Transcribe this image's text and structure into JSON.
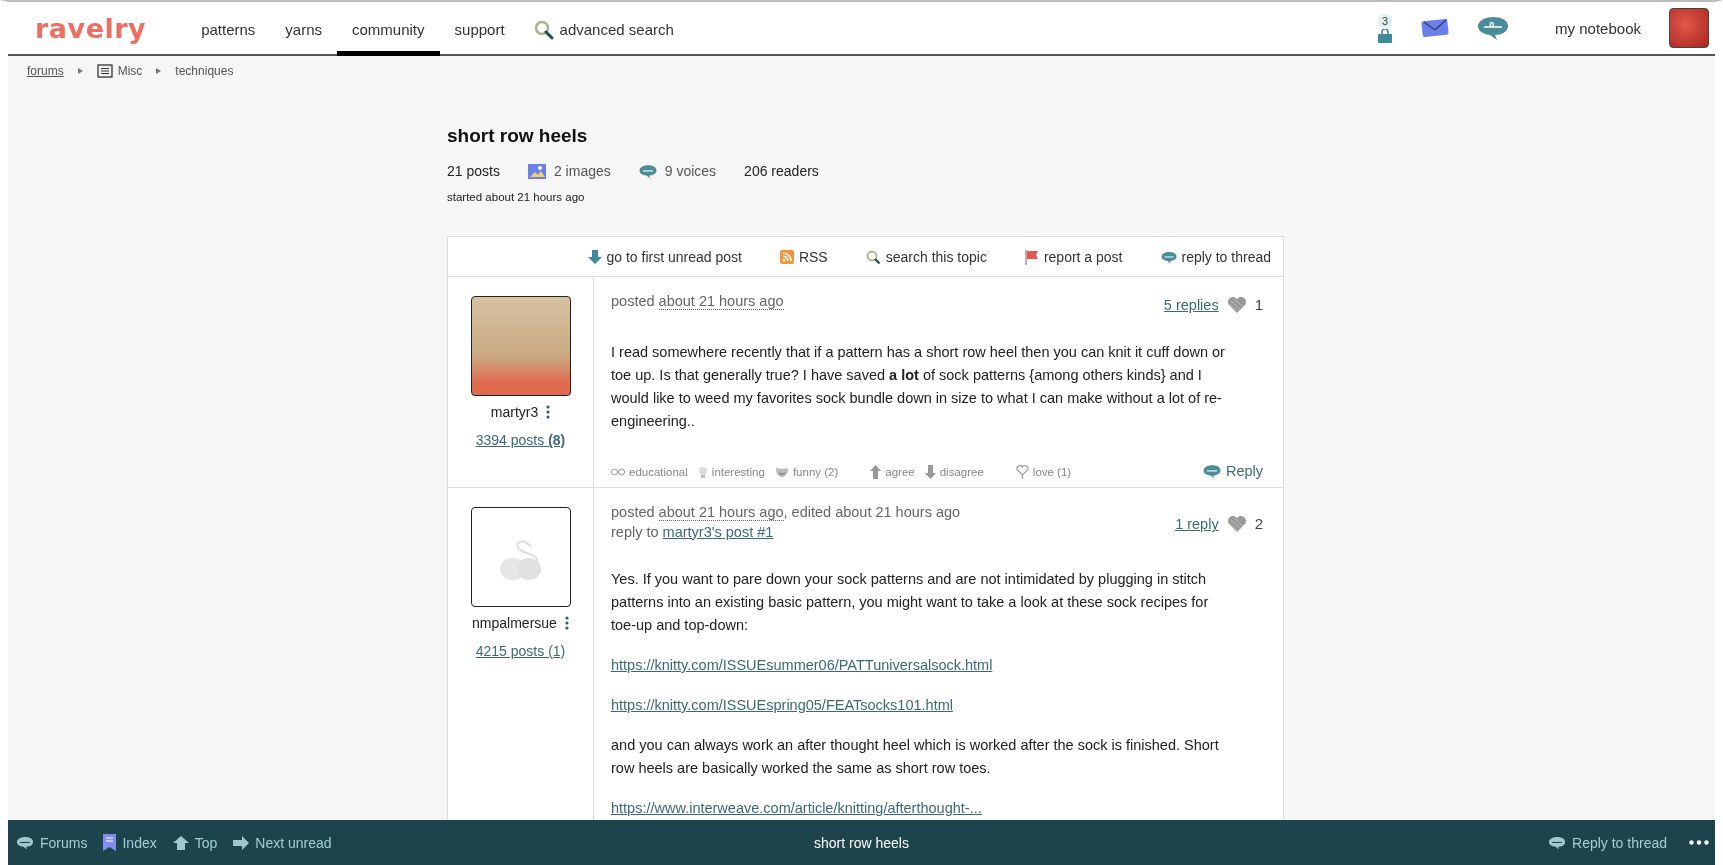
{
  "header": {
    "logo": "ravelry",
    "nav": [
      {
        "label": "patterns",
        "selected": false
      },
      {
        "label": "yarns",
        "selected": false
      },
      {
        "label": "community",
        "selected": true
      },
      {
        "label": "support",
        "selected": false
      }
    ],
    "search_link": "advanced search",
    "cart_badge": "3",
    "notebook": "my notebook"
  },
  "breadcrumb": [
    {
      "label": "forums",
      "kind": "link"
    },
    {
      "label": "Misc",
      "kind": "board"
    },
    {
      "label": "techniques",
      "kind": "plain"
    }
  ],
  "topic": {
    "title": "short row heels",
    "posts": "21 posts",
    "images": "2 images",
    "voices": "9 voices",
    "readers": "206 readers",
    "started": "started about 21 hours ago"
  },
  "toolbar": [
    {
      "label": "go to first unread post",
      "kind": "down"
    },
    {
      "label": "RSS",
      "kind": "rss"
    },
    {
      "label": "search this topic",
      "kind": "search"
    },
    {
      "label": "report a post",
      "kind": "flag"
    },
    {
      "label": "reply to thread",
      "kind": "bubble"
    }
  ],
  "posts": [
    {
      "author": "martyr3",
      "kind": "photo",
      "posts_link": "3394 posts **(8)**",
      "posted": "posted",
      "time": "about 21 hours ago",
      "replies": "5 replies",
      "likes": "1",
      "body": [
        {
          "kind": "text",
          "text": "I read somewhere recently that if a pattern has a short row heel then you can knit it cuff down or toe up. Is that generally true? I have saved **a lot** of sock patterns {among others kinds} and I would like to weed my favorites sock bundle down in size to what I can make without a lot of re-engineering.."
        }
      ],
      "reactions": [
        {
          "label": "educational",
          "kind": "glasses"
        },
        {
          "label": "interesting",
          "kind": "bulb"
        },
        {
          "label": "funny (2)",
          "kind": "mask"
        },
        {
          "label": "agree",
          "kind": "up"
        },
        {
          "label": "disagree",
          "kind": "down"
        },
        {
          "label": "love (1)",
          "kind": "heart"
        }
      ],
      "reply": "Reply"
    },
    {
      "author": "nmpalmersue",
      "kind": "default",
      "posts_link": "4215 posts (1)",
      "posted": "posted",
      "time": "about 21 hours ago",
      "edited": ", edited about 21 hours ago",
      "reply_to_label": "reply to",
      "reply_to": "martyr3's post #1",
      "replies": "1 reply",
      "likes": "2",
      "body": [
        {
          "kind": "text",
          "text": "Yes. If you want to pare down your sock patterns and are not intimidated by plugging in stitch patterns into an existing basic pattern, you might want to take a look at these sock recipes for toe-up and top-down:"
        },
        {
          "kind": "link",
          "text": "https://knitty.com/ISSUEsummer06/PATTuniversalsock.html"
        },
        {
          "kind": "link",
          "text": "https://knitty.com/ISSUEspring05/FEATsocks101.html"
        },
        {
          "kind": "text",
          "text": "and you can always work an after thought heel which is worked after the sock is finished. Short row heels are basically worked the same as short row toes."
        },
        {
          "kind": "link",
          "text": "https://www.interweave.com/article/knitting/afterthought-..."
        }
      ]
    }
  ],
  "footer": {
    "left": [
      {
        "label": "Forums",
        "kind": "bubble"
      },
      {
        "label": "Index",
        "kind": "bookmark"
      },
      {
        "label": "Top",
        "kind": "up"
      },
      {
        "label": "Next unread",
        "kind": "next"
      }
    ],
    "title": "short row heels",
    "right": "Reply to thread"
  }
}
